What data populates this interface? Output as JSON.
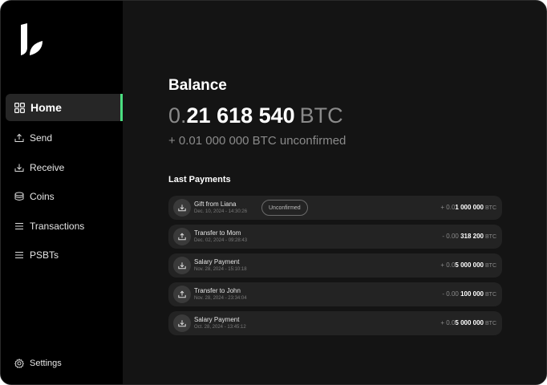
{
  "sidebar": {
    "logo": "liana-logo",
    "items": [
      {
        "label": "Home",
        "icon": "grid-icon",
        "active": true
      },
      {
        "label": "Send",
        "icon": "send-icon"
      },
      {
        "label": "Receive",
        "icon": "receive-icon"
      },
      {
        "label": "Coins",
        "icon": "coins-icon"
      },
      {
        "label": "Transactions",
        "icon": "list-icon"
      },
      {
        "label": "PSBTs",
        "icon": "list-icon"
      }
    ],
    "settings_label": "Settings"
  },
  "main": {
    "balance_title": "Balance",
    "balance": {
      "prefix": "0.",
      "main": "21 618 540",
      "unit": "BTC"
    },
    "unconfirmed": "+ 0.01 000 000 BTC unconfirmed",
    "payments_title": "Last Payments",
    "payments": [
      {
        "label": "Gift from Liana",
        "date": "Dec. 10, 2024 - 14:30:26",
        "badge": "Unconfirmed",
        "direction": "incoming",
        "sign_prefix": "+ 0.0",
        "amount_strong": "1 000 000",
        "unit": "BTC"
      },
      {
        "label": "Transfer to Mom",
        "date": "Dec. 02, 2024 - 09:28:43",
        "direction": "outgoing",
        "sign_prefix": "- 0.00 ",
        "amount_strong": "318 200",
        "unit": "BTC"
      },
      {
        "label": "Salary Payment",
        "date": "Nov. 28, 2024 - 15:10:18",
        "direction": "incoming",
        "sign_prefix": "+ 0.0",
        "amount_strong": "5 000 000",
        "unit": "BTC"
      },
      {
        "label": "Transfer to John",
        "date": "Nov. 28, 2024 - 23:34:04",
        "direction": "outgoing",
        "sign_prefix": "- 0.00 ",
        "amount_strong": "100 000",
        "unit": "BTC"
      },
      {
        "label": "Salary Payment",
        "date": "Oct. 28, 2024 - 13:45:12",
        "direction": "incoming",
        "sign_prefix": "+ 0.0",
        "amount_strong": "5 000 000",
        "unit": "BTC"
      }
    ]
  },
  "colors": {
    "accent": "#4ade80",
    "sidebar_bg": "#000000",
    "main_bg": "#141414",
    "row_bg": "#232323"
  }
}
